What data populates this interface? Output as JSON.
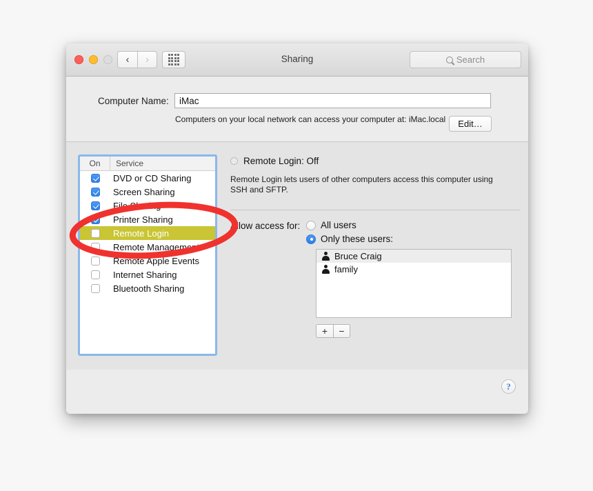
{
  "window": {
    "title": "Sharing",
    "traffic_lights": [
      "close",
      "minimize",
      "zoom"
    ],
    "nav": {
      "back": "‹",
      "forward": "›",
      "grid_icon": "grid-icon"
    },
    "search": {
      "placeholder": "Search",
      "value": "",
      "icon": "search-icon"
    }
  },
  "computer_name": {
    "label": "Computer Name:",
    "value": "iMac",
    "description": "Computers on your local network can access your computer at:\niMac.local",
    "edit_button": "Edit…"
  },
  "services": {
    "columns": {
      "on": "On",
      "service": "Service"
    },
    "items": [
      {
        "name": "DVD or CD Sharing",
        "checked": true,
        "selected": false
      },
      {
        "name": "Screen Sharing",
        "checked": true,
        "selected": false
      },
      {
        "name": "File Sharing",
        "checked": true,
        "selected": false
      },
      {
        "name": "Printer Sharing",
        "checked": true,
        "selected": false
      },
      {
        "name": "Remote Login",
        "checked": false,
        "selected": true
      },
      {
        "name": "Remote Management",
        "checked": false,
        "selected": false
      },
      {
        "name": "Remote Apple Events",
        "checked": false,
        "selected": false
      },
      {
        "name": "Internet Sharing",
        "checked": false,
        "selected": false
      },
      {
        "name": "Bluetooth Sharing",
        "checked": false,
        "selected": false
      }
    ]
  },
  "detail": {
    "status_label": "Remote Login: Off",
    "status_on": false,
    "description": "Remote Login lets users of other computers access this computer using SSH and SFTP.",
    "access_label": "Allow access for:",
    "access_options": [
      {
        "label": "All users",
        "selected": false
      },
      {
        "label": "Only these users:",
        "selected": true
      }
    ],
    "users": [
      {
        "name": "Bruce Craig",
        "icon": "person-icon"
      },
      {
        "name": "family",
        "icon": "person-icon"
      }
    ],
    "add_button": "+",
    "remove_button": "−"
  },
  "footer": {
    "help_button": "?"
  },
  "annotation": {
    "shape": "ellipse",
    "color": "#f0322e",
    "stroke_width": 9
  },
  "colors": {
    "selection_highlight": "#c9c534",
    "checkbox_on": "#2e7fe8",
    "radio_on": "#2e7fe8",
    "focus_ring": "#8ab8ea",
    "annotation_red": "#f0322e",
    "help_blue": "#3a7fe0"
  }
}
